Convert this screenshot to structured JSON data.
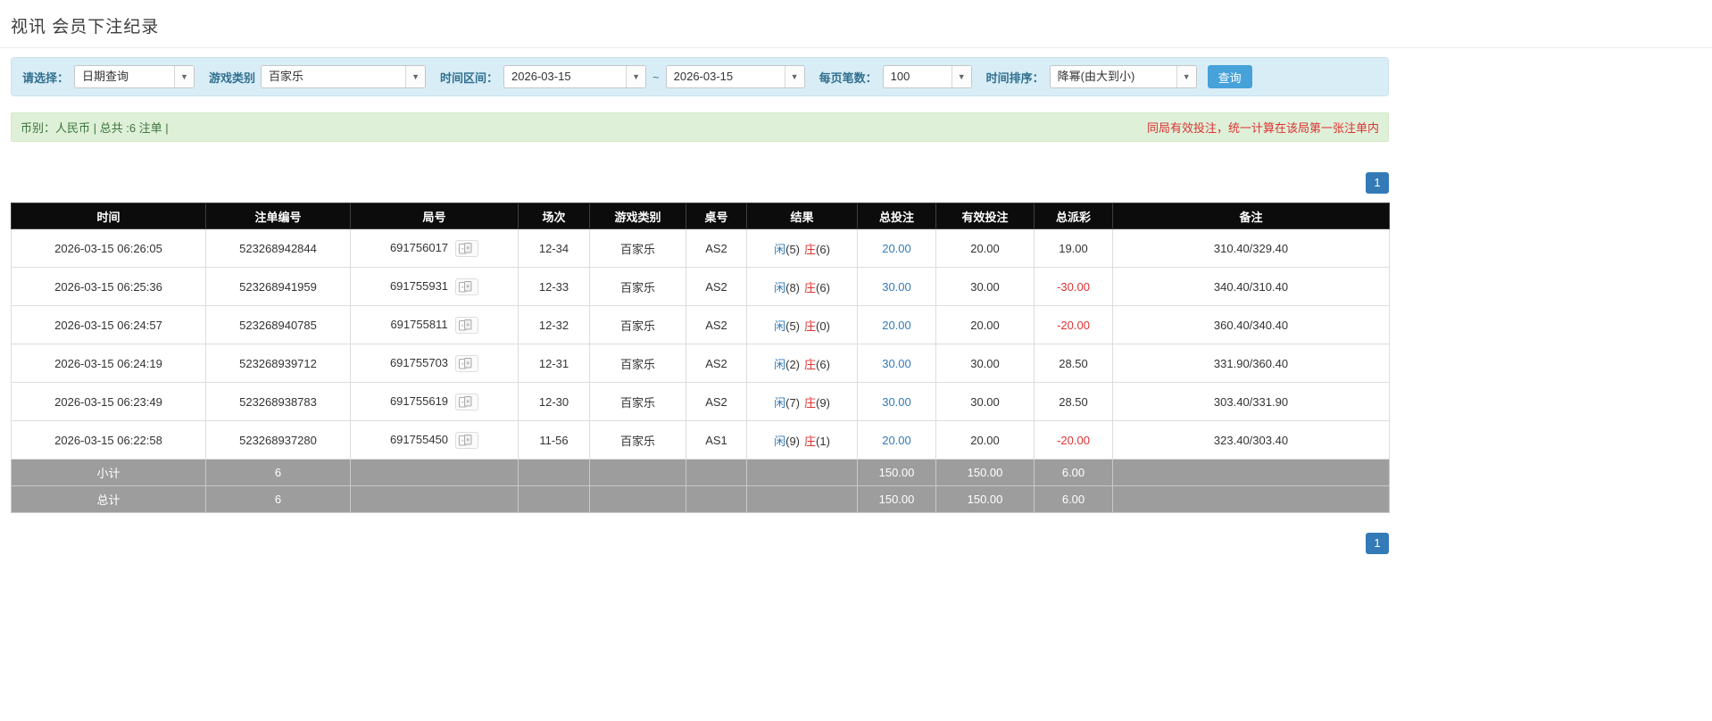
{
  "page": {
    "title": "视讯 会员下注纪录"
  },
  "colors": {
    "header_bg": "#0c0c0c",
    "accent_blue": "#337ab7",
    "note_red": "#dd3333",
    "panel_blue": "#d9edf7",
    "panel_green": "#dff0d8",
    "footer_gray": "#9d9d9d",
    "button_blue": "#46a2d9",
    "label_color": "#31708f",
    "success_text": "#3c763d"
  },
  "filters": {
    "select_label": "请选择：",
    "select_value": "日期查询",
    "game_label": "游戏类别",
    "game_value": "百家乐",
    "range_label": "时间区间：",
    "date_from": "2026-03-15",
    "tilde": "~",
    "date_to": "2026-03-15",
    "page_size_label": "每页笔数：",
    "page_size_value": "100",
    "sort_label": "时间排序：",
    "sort_value": "降幂(由大到小)",
    "search_label": "查询"
  },
  "summary": {
    "currency_info": "币别：人民币 | 总共 :6 注单 |",
    "note_right": "同局有效投注，统一计算在该局第一张注单内"
  },
  "pagination": {
    "current": "1"
  },
  "table": {
    "headers": [
      "时间",
      "注单编号",
      "局号",
      "场次",
      "游戏类别",
      "桌号",
      "结果",
      "总投注",
      "有效投注",
      "总派彩",
      "备注"
    ],
    "rows": [
      {
        "time": "2026-03-15 06:26:05",
        "bet_no": "523268942844",
        "round_no": "691756017",
        "session": "12-34",
        "game": "百家乐",
        "table_no": "AS2",
        "result_p": "闲",
        "result_p_num": "(5)",
        "result_b": "庄",
        "result_b_num": "(6)",
        "total_bet": "20.00",
        "valid_bet": "20.00",
        "payout": "19.00",
        "note": "310.40/329.40"
      },
      {
        "time": "2026-03-15 06:25:36",
        "bet_no": "523268941959",
        "round_no": "691755931",
        "session": "12-33",
        "game": "百家乐",
        "table_no": "AS2",
        "result_p": "闲",
        "result_p_num": "(8)",
        "result_b": "庄",
        "result_b_num": "(6)",
        "total_bet": "30.00",
        "valid_bet": "30.00",
        "payout": "-30.00",
        "note": "340.40/310.40"
      },
      {
        "time": "2026-03-15 06:24:57",
        "bet_no": "523268940785",
        "round_no": "691755811",
        "session": "12-32",
        "game": "百家乐",
        "table_no": "AS2",
        "result_p": "闲",
        "result_p_num": "(5)",
        "result_b": "庄",
        "result_b_num": "(0)",
        "total_bet": "20.00",
        "valid_bet": "20.00",
        "payout": "-20.00",
        "note": "360.40/340.40"
      },
      {
        "time": "2026-03-15 06:24:19",
        "bet_no": "523268939712",
        "round_no": "691755703",
        "session": "12-31",
        "game": "百家乐",
        "table_no": "AS2",
        "result_p": "闲",
        "result_p_num": "(2)",
        "result_b": "庄",
        "result_b_num": "(6)",
        "total_bet": "30.00",
        "valid_bet": "30.00",
        "payout": "28.50",
        "note": "331.90/360.40"
      },
      {
        "time": "2026-03-15 06:23:49",
        "bet_no": "523268938783",
        "round_no": "691755619",
        "session": "12-30",
        "game": "百家乐",
        "table_no": "AS2",
        "result_p": "闲",
        "result_p_num": "(7)",
        "result_b": "庄",
        "result_b_num": "(9)",
        "total_bet": "30.00",
        "valid_bet": "30.00",
        "payout": "28.50",
        "note": "303.40/331.90"
      },
      {
        "time": "2026-03-15 06:22:58",
        "bet_no": "523268937280",
        "round_no": "691755450",
        "session": "11-56",
        "game": "百家乐",
        "table_no": "AS1",
        "result_p": "闲",
        "result_p_num": "(9)",
        "result_b": "庄",
        "result_b_num": "(1)",
        "total_bet": "20.00",
        "valid_bet": "20.00",
        "payout": "-20.00",
        "note": "323.40/303.40"
      }
    ],
    "footer": [
      {
        "label": "小计",
        "count": "6",
        "total_bet": "150.00",
        "valid_bet": "150.00",
        "payout": "6.00"
      },
      {
        "label": "总计",
        "count": "6",
        "total_bet": "150.00",
        "valid_bet": "150.00",
        "payout": "6.00"
      }
    ]
  }
}
